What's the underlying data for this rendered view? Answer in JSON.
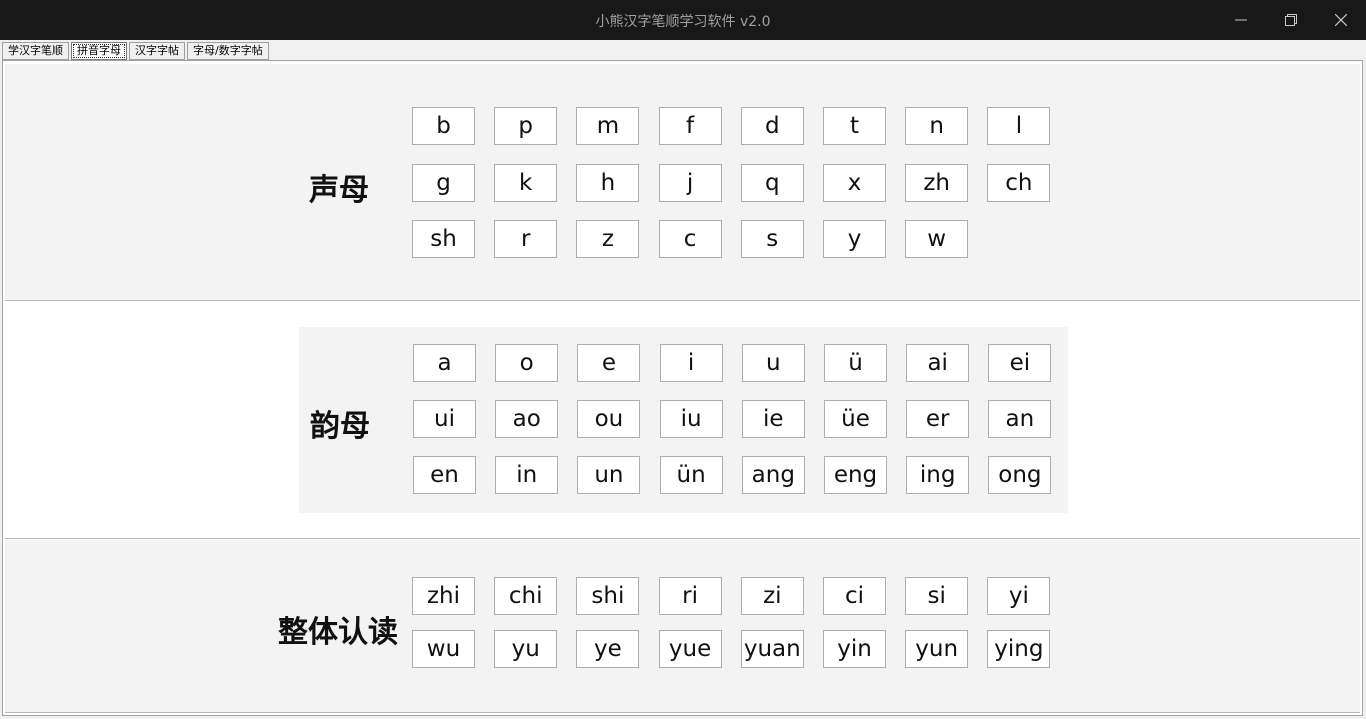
{
  "window": {
    "title": "小熊汉字笔顺学习软件 v2.0",
    "controls": [
      "minimize-icon",
      "restore-icon",
      "close-icon"
    ]
  },
  "tabs": [
    {
      "label": "学汉字笔顺",
      "active": false
    },
    {
      "label": "拼音字母",
      "active": true
    },
    {
      "label": "汉字字帖",
      "active": false
    },
    {
      "label": "字母/数字字帖",
      "active": false
    }
  ],
  "shengmu": {
    "label": "声母",
    "rows": [
      [
        "b",
        "p",
        "m",
        "f",
        "d",
        "t",
        "n",
        "l"
      ],
      [
        "g",
        "k",
        "h",
        "j",
        "q",
        "x",
        "zh",
        "ch"
      ],
      [
        "sh",
        "r",
        "z",
        "c",
        "s",
        "y",
        "w"
      ]
    ]
  },
  "yunmu": {
    "label": "韵母",
    "rows": [
      [
        "a",
        "o",
        "e",
        "i",
        "u",
        "ü",
        "ai",
        "ei"
      ],
      [
        "ui",
        "ao",
        "ou",
        "iu",
        "ie",
        "üe",
        "er",
        "an"
      ],
      [
        "en",
        "in",
        "un",
        "ün",
        "ang",
        "eng",
        "ing",
        "ong"
      ]
    ]
  },
  "zhengti": {
    "label": "整体认读",
    "rows": [
      [
        "zhi",
        "chi",
        "shi",
        "ri",
        "zi",
        "ci",
        "si",
        "yi"
      ],
      [
        "wu",
        "yu",
        "ye",
        "yue",
        "yuan",
        "yin",
        "yun",
        "ying"
      ]
    ]
  }
}
